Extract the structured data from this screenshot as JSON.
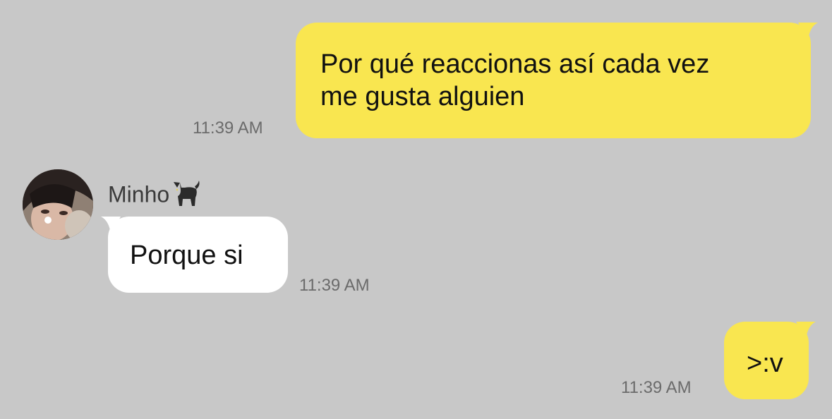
{
  "colors": {
    "background": "#c8c8c8",
    "outgoing_bubble": "#f9e650",
    "incoming_bubble": "#ffffff",
    "timestamp": "#6b6b6b"
  },
  "messages": [
    {
      "direction": "outgoing",
      "lines": [
        "Por qué reaccionas así cada vez",
        "me gusta alguien"
      ],
      "time": "11:39 AM"
    },
    {
      "direction": "incoming",
      "sender": "Minho",
      "sender_emoji": "black-cat-emoji",
      "avatar": "profile-photo",
      "text": "Porque si",
      "time": "11:39 AM"
    },
    {
      "direction": "outgoing",
      "text": ">:v",
      "time": "11:39 AM"
    }
  ]
}
